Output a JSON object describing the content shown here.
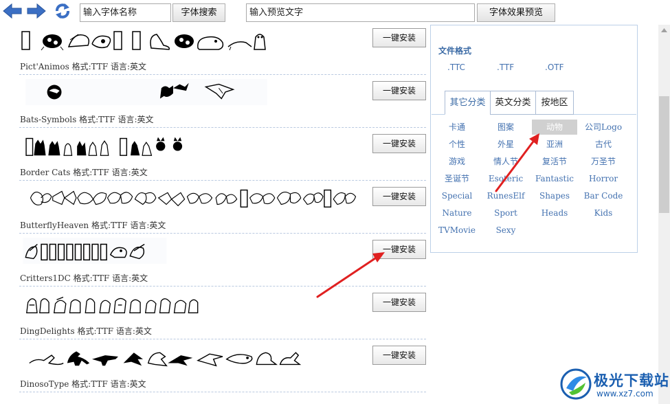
{
  "toolbar": {
    "font_name_input": "输入字体名称",
    "font_search_button": "字体搜索",
    "preview_text_input": "输入预览文字",
    "preview_effect_button": "字体效果预览"
  },
  "fonts": [
    {
      "caption": "Pict'Animos 格式:TTF 语言:英文",
      "install_label": "一键安装",
      "preview": "animals"
    },
    {
      "caption": "Bats-Symbols 格式:TTF 语言:英文",
      "install_label": "一键安装",
      "preview": "bats"
    },
    {
      "caption": "Border Cats 格式:TTF 语言:英文",
      "install_label": "一键安装",
      "preview": "cats"
    },
    {
      "caption": "ButterflyHeaven 格式:TTF 语言:英文",
      "install_label": "一键安装",
      "preview": "butterflies"
    },
    {
      "caption": "Critters1DC 格式:TTF 语言:英文",
      "install_label": "一键安装",
      "preview": "critters"
    },
    {
      "caption": "DingDelights 格式:TTF 语言:英文",
      "install_label": "一键安装",
      "preview": "ding"
    },
    {
      "caption": "DinosoType 格式:TTF 语言:英文",
      "install_label": "一键安装",
      "preview": "dinos"
    }
  ],
  "panel": {
    "format_title": "文件格式",
    "formats": [
      ".TTC",
      ".TTF",
      ".OTF"
    ],
    "tabs": [
      {
        "label": "其它分类",
        "active": true
      },
      {
        "label": "英文分类",
        "active": false
      },
      {
        "label": "按地区",
        "active": false
      }
    ],
    "categories": [
      {
        "label": "卡通",
        "selected": false
      },
      {
        "label": "图案",
        "selected": false
      },
      {
        "label": "动物",
        "selected": true
      },
      {
        "label": "公司Logo",
        "selected": false
      },
      {
        "label": "个性",
        "selected": false
      },
      {
        "label": "外星",
        "selected": false
      },
      {
        "label": "亚洲",
        "selected": false
      },
      {
        "label": "古代",
        "selected": false
      },
      {
        "label": "游戏",
        "selected": false
      },
      {
        "label": "情人节",
        "selected": false
      },
      {
        "label": "复活节",
        "selected": false
      },
      {
        "label": "万圣节",
        "selected": false
      },
      {
        "label": "圣诞节",
        "selected": false
      },
      {
        "label": "Esoteric",
        "selected": false
      },
      {
        "label": "Fantastic",
        "selected": false
      },
      {
        "label": "Horror",
        "selected": false
      },
      {
        "label": "Special",
        "selected": false
      },
      {
        "label": "RunesElf",
        "selected": false
      },
      {
        "label": "Shapes",
        "selected": false
      },
      {
        "label": "Bar Code",
        "selected": false
      },
      {
        "label": "Nature",
        "selected": false
      },
      {
        "label": "Sport",
        "selected": false
      },
      {
        "label": "Heads",
        "selected": false
      },
      {
        "label": "Kids",
        "selected": false
      },
      {
        "label": "TVMovie",
        "selected": false
      },
      {
        "label": "Sexy",
        "selected": false
      }
    ]
  },
  "watermark": {
    "text": "极光下载站",
    "url": "www.xz7.com"
  },
  "colors": {
    "nav_arrow": "#3b6fc4",
    "link": "#4472b0",
    "annotation_arrow": "#e02020",
    "panel_border": "#bcd0e8"
  }
}
